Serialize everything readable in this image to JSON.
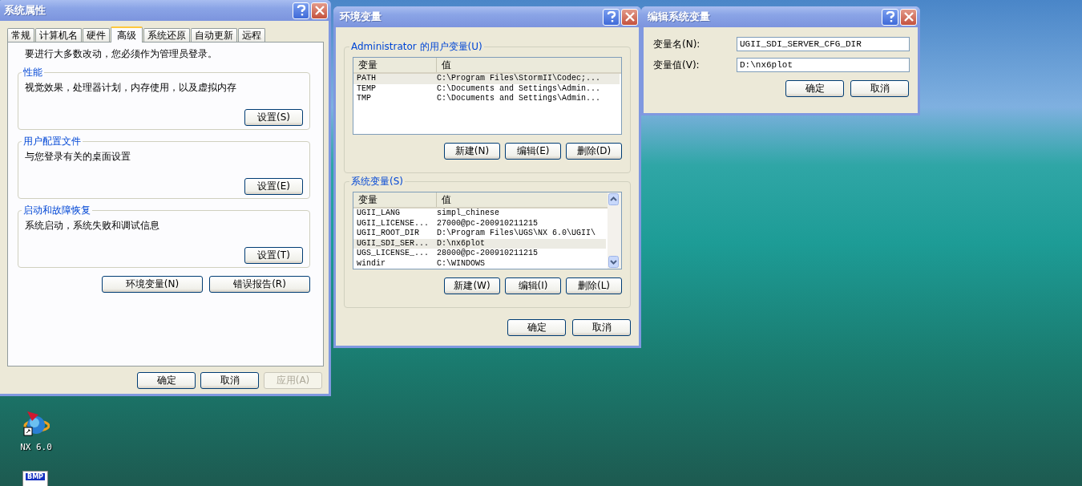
{
  "desktop": {
    "icons": [
      {
        "kind": "nx",
        "label": "NX 6.0"
      },
      {
        "kind": "bmp",
        "badge": "BMP"
      }
    ]
  },
  "system_properties": {
    "title": "系统属性",
    "tabs": [
      {
        "label": "常规",
        "selected": false
      },
      {
        "label": "计算机名",
        "selected": false
      },
      {
        "label": "硬件",
        "selected": false
      },
      {
        "label": "高级",
        "selected": true
      },
      {
        "label": "系统还原",
        "selected": false
      },
      {
        "label": "自动更新",
        "selected": false
      },
      {
        "label": "远程",
        "selected": false
      }
    ],
    "note": "要进行大多数改动，您必须作为管理员登录。",
    "groups": [
      {
        "title": "性能",
        "description": "视觉效果，处理器计划，内存使用，以及虚拟内存",
        "button": "设置(S)"
      },
      {
        "title": "用户配置文件",
        "description": "与您登录有关的桌面设置",
        "button": "设置(E)"
      },
      {
        "title": "启动和故障恢复",
        "description": "系统启动，系统失败和调试信息",
        "button": "设置(T)"
      }
    ],
    "extra_buttons": [
      "环境变量(N)",
      "错误报告(R)"
    ],
    "footer_buttons": [
      {
        "label": "确定",
        "disabled": false
      },
      {
        "label": "取消",
        "disabled": false
      },
      {
        "label": "应用(A)",
        "disabled": true
      }
    ]
  },
  "environment_variables": {
    "title": "环境变量",
    "user_vars": {
      "title": "Administrator 的用户变量(U)",
      "columns": [
        "变量",
        "值"
      ],
      "rows": [
        {
          "name": "PATH",
          "value": "C:\\Program Files\\StormII\\Codec;...",
          "selected": true
        },
        {
          "name": "TEMP",
          "value": "C:\\Documents and Settings\\Admin...",
          "selected": false
        },
        {
          "name": "TMP",
          "value": "C:\\Documents and Settings\\Admin...",
          "selected": false
        }
      ],
      "buttons": [
        "新建(N)",
        "编辑(E)",
        "删除(D)"
      ]
    },
    "system_vars": {
      "title": "系统变量(S)",
      "columns": [
        "变量",
        "值"
      ],
      "rows": [
        {
          "name": "UGII_LANG",
          "value": "simpl_chinese",
          "selected": false
        },
        {
          "name": "UGII_LICENSE...",
          "value": "27000@pc-200910211215",
          "selected": false
        },
        {
          "name": "UGII_ROOT_DIR",
          "value": "D:\\Program Files\\UGS\\NX 6.0\\UGII\\",
          "selected": false
        },
        {
          "name": "UGII_SDI_SER...",
          "value": "D:\\nx6plot",
          "selected": true
        },
        {
          "name": "UGS_LICENSE_...",
          "value": "28000@pc-200910211215",
          "selected": false
        },
        {
          "name": "windir",
          "value": "C:\\WINDOWS",
          "selected": false
        }
      ],
      "buttons": [
        "新建(W)",
        "编辑(I)",
        "删除(L)"
      ]
    },
    "footer_buttons": [
      "确定",
      "取消"
    ]
  },
  "edit_system_variable": {
    "title": "编辑系统变量",
    "fields": [
      {
        "label": "变量名(N):",
        "value": "UGII_SDI_SERVER_CFG_DIR"
      },
      {
        "label": "变量值(V):",
        "value": "D:\\nx6plot"
      }
    ],
    "buttons": [
      "确定",
      "取消"
    ]
  }
}
